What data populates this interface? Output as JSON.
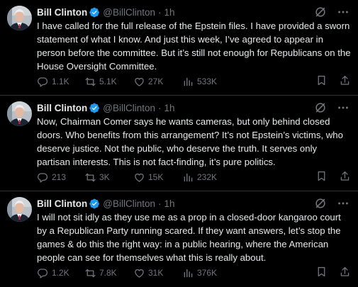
{
  "tweets": [
    {
      "name": "Bill Clinton",
      "handle": "@BillClinton",
      "separator": "·",
      "time": "1h",
      "text": "I have called for the full release of the Epstein files. I have provided a sworn statement of what I know. And just this week, I’ve agreed to appear in person before the committee. But it’s still not enough for Republicans on the House Oversight Committee.",
      "replies": "1.1K",
      "reposts": "5.1K",
      "likes": "27K",
      "views": "533K"
    },
    {
      "name": "Bill Clinton",
      "handle": "@BillClinton",
      "separator": "·",
      "time": "1h",
      "text": "Now, Chairman Comer says he wants cameras, but only behind closed doors. Who benefits from this arrangement? It’s not Epstein’s victims, who deserve justice. Not the public, who deserve the truth. It serves only partisan interests. This is not fact-finding, it’s pure politics.",
      "replies": "213",
      "reposts": "3K",
      "likes": "15K",
      "views": "232K"
    },
    {
      "name": "Bill Clinton",
      "handle": "@BillClinton",
      "separator": "·",
      "time": "1h",
      "text": "I will not sit idly as they use me as a prop in a closed-door kangaroo court by a Republican Party running scared. If they want answers, let’s stop the games & do this the right way: in a public hearing, where the American people can see for themselves what this is really about.",
      "replies": "1.2K",
      "reposts": "7.8K",
      "likes": "31K",
      "views": "376K"
    }
  ],
  "icons": {
    "verified": "verified-badge-icon",
    "grok": "grok-icon",
    "more": "more-icon",
    "reply": "reply-icon",
    "repost": "repost-icon",
    "like": "heart-icon",
    "views": "views-icon",
    "bookmark": "bookmark-icon",
    "share": "share-icon"
  },
  "colors": {
    "background": "#000000",
    "text": "#e7e9ea",
    "muted": "#71767b",
    "verified": "#1d9bf0",
    "divider": "#2f3336"
  }
}
